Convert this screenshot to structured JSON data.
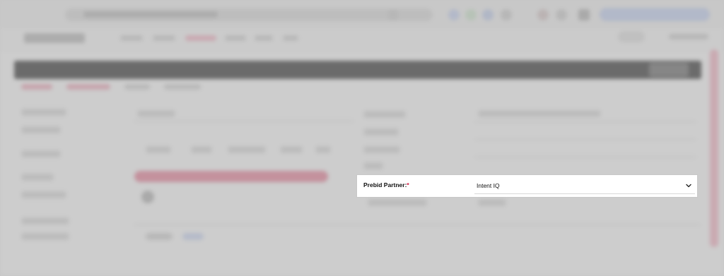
{
  "form_field": {
    "label": "Prebid Partner:",
    "required_marker": "*",
    "selected_value": "Intent IQ",
    "dropdown_icon": "chevron-down-icon"
  },
  "colors": {
    "required": "#d0103a",
    "accent": "#e58ea2",
    "overlay": "#969696"
  }
}
